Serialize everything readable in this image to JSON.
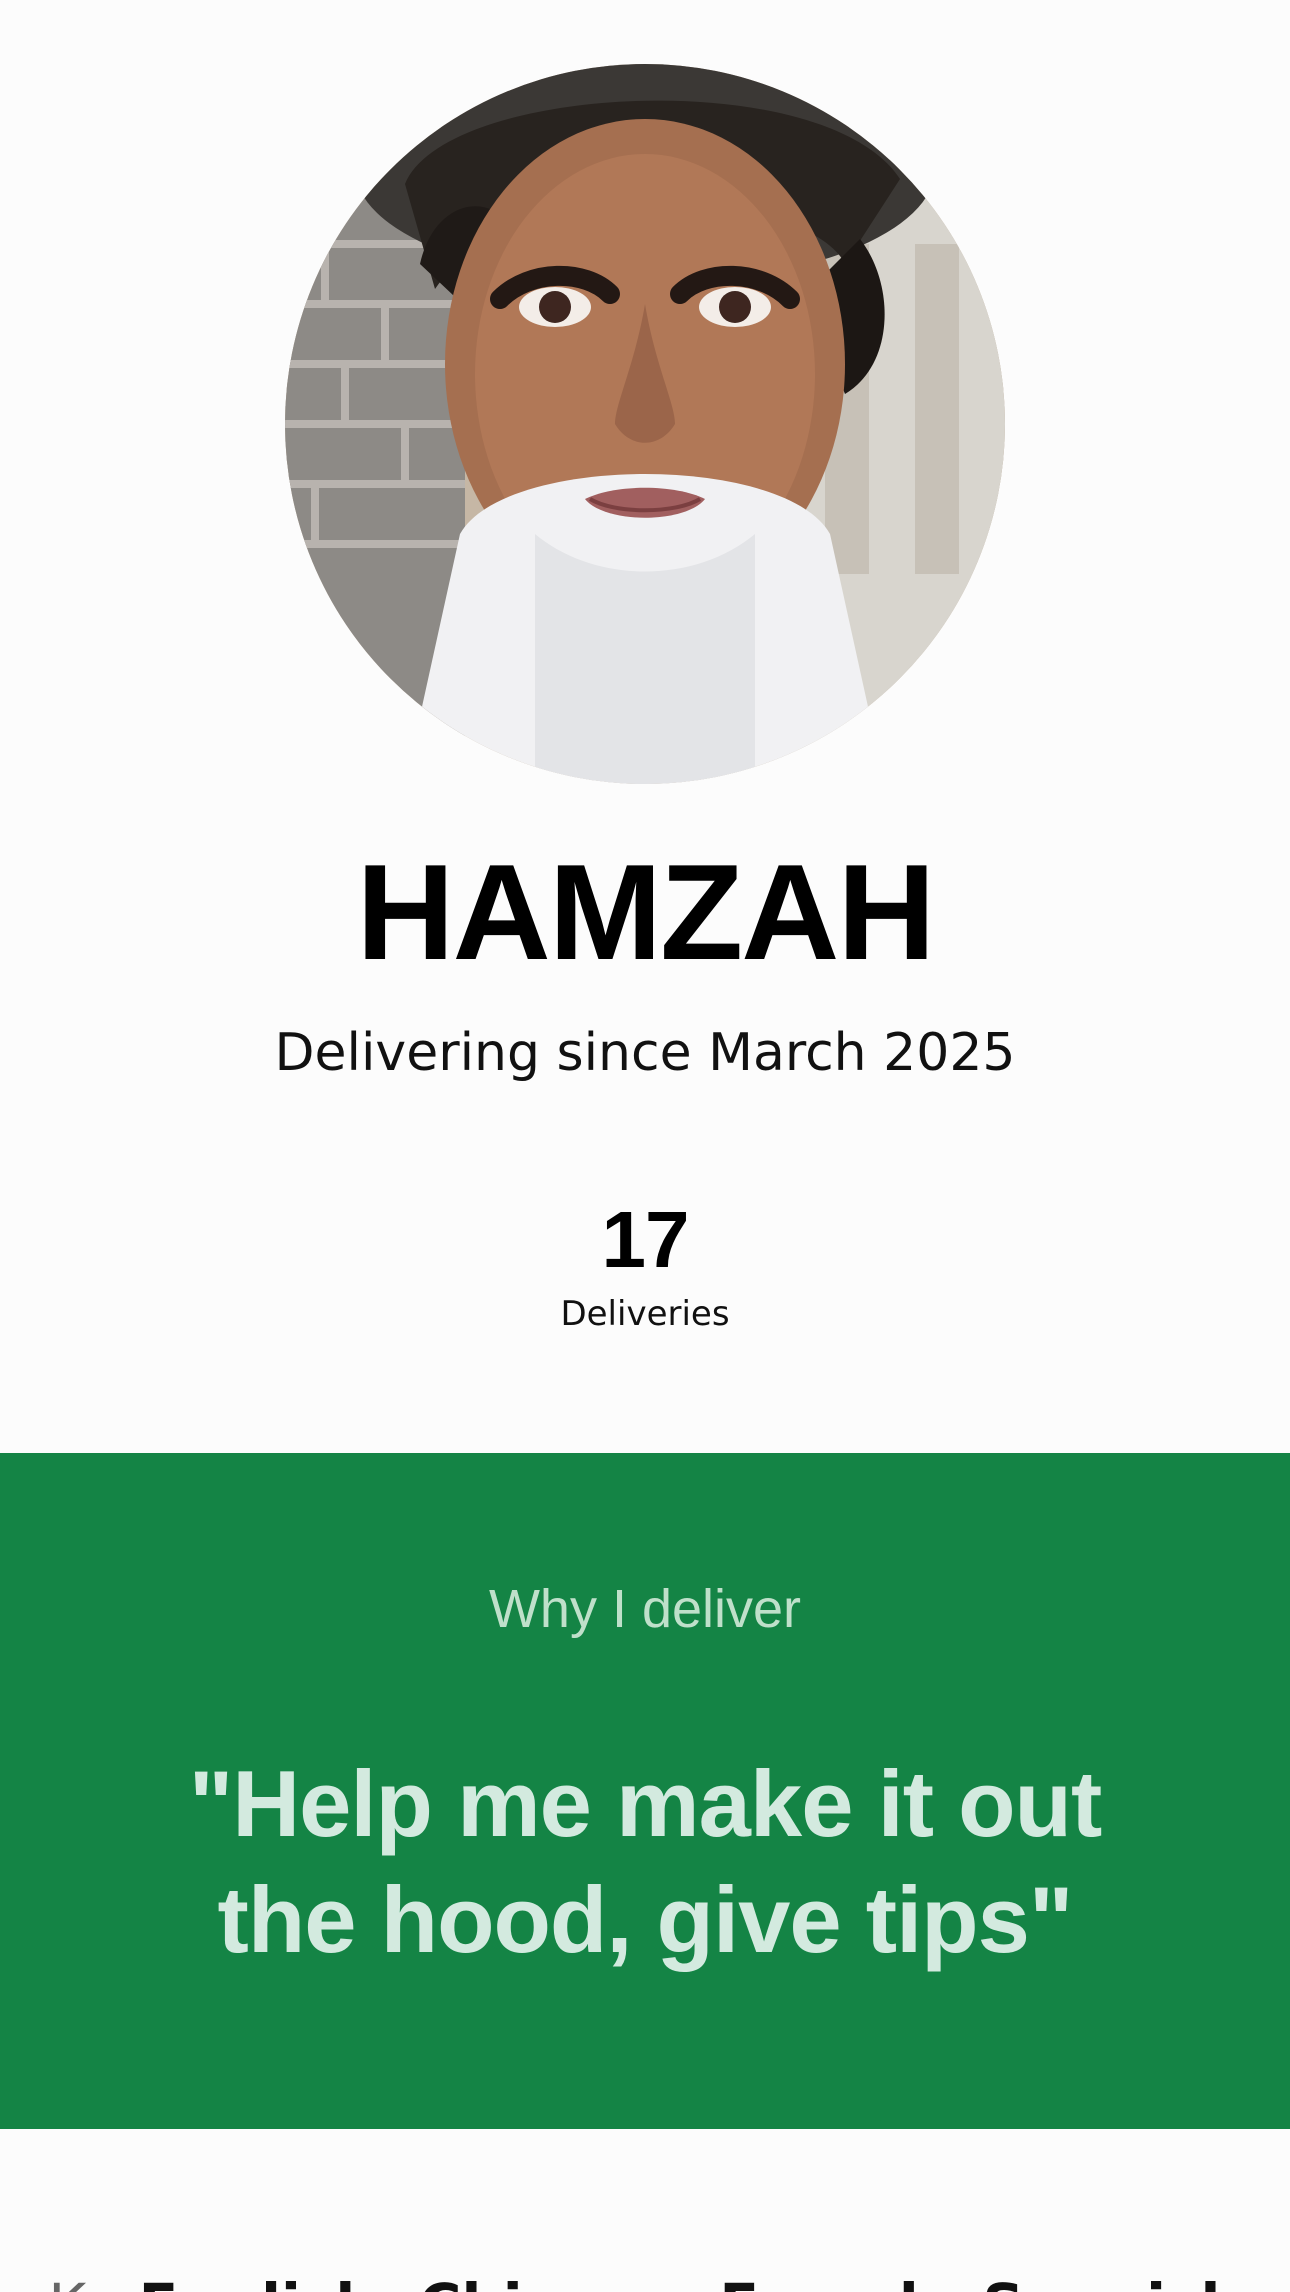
{
  "profile": {
    "name": "HAMZAH",
    "since": "Delivering since March 2025"
  },
  "stats": {
    "value": "17",
    "label": "Deliveries"
  },
  "why": {
    "label": "Why I deliver",
    "quote": "\"Help me make it out the hood, give tips\""
  },
  "languages": {
    "label": "K",
    "value": "English, Chinese, French, Spanish"
  },
  "colors": {
    "background": "#fcfcfc",
    "accent_green": "#148445",
    "quote_text": "#d3eadf",
    "label_text": "#bfe0ca"
  },
  "icons": {
    "avatar": "profile-photo"
  }
}
